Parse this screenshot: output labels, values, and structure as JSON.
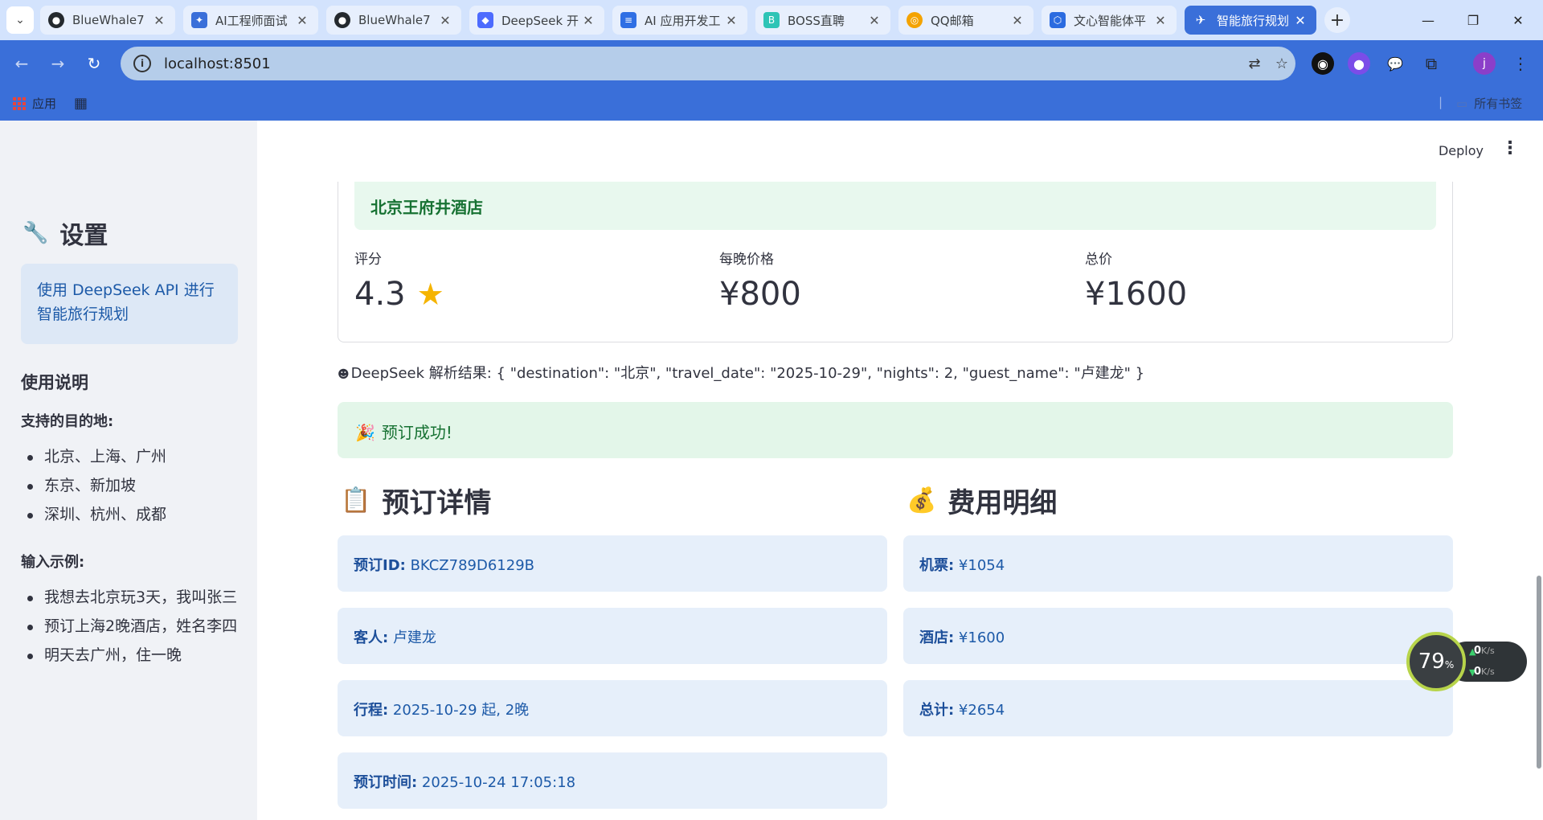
{
  "browser": {
    "tabs": [
      {
        "title": "BlueWhale7",
        "icon": "github-icon",
        "color": "#24292e"
      },
      {
        "title": "AI工程师面试",
        "icon": "bird-icon",
        "color": "#3a6fd9"
      },
      {
        "title": "BlueWhale7",
        "icon": "github-icon",
        "color": "#24292e"
      },
      {
        "title": "DeepSeek 开",
        "icon": "whale-icon",
        "color": "#4d6bfe"
      },
      {
        "title": "AI 应用开发工",
        "icon": "doc-icon",
        "color": "#2f6fe4"
      },
      {
        "title": "BOSS直聘",
        "icon": "boss-icon",
        "color": "#2ec4b6"
      },
      {
        "title": "QQ邮箱",
        "icon": "qqmail-icon",
        "color": "#f4a300"
      },
      {
        "title": "文心智能体平",
        "icon": "cube-icon",
        "color": "#2b6be0"
      },
      {
        "title": "智能旅行规划",
        "icon": "plane-icon",
        "color": "#ffffff"
      }
    ],
    "url": "localhost:8501",
    "bookmarks": {
      "apps_label": "应用",
      "all_bookmarks_label": "所有书签"
    }
  },
  "header": {
    "deploy_label": "Deploy"
  },
  "sidebar": {
    "title": "设置",
    "info": "使用 DeepSeek API 进行智能旅行规划",
    "usage_heading": "使用说明",
    "destinations_heading": "支持的目的地:",
    "destinations": [
      "北京、上海、广州",
      "东京、新加坡",
      "深圳、杭州、成都"
    ],
    "examples_heading": "输入示例:",
    "examples": [
      "我想去北京玩3天，我叫张三",
      "预订上海2晚酒店，姓名李四",
      "明天去广州，住一晚"
    ]
  },
  "hotel": {
    "name": "北京王府井酒店",
    "rating_label": "评分",
    "rating_value": "4.3",
    "nightly_label": "每晚价格",
    "nightly_value": "¥800",
    "total_label": "总价",
    "total_value": "¥1600"
  },
  "parse_result": "DeepSeek 解析结果: { \"destination\": \"北京\", \"travel_date\": \"2025-10-29\", \"nights\": 2, \"guest_name\": \"卢建龙\" }",
  "success_message": "预订成功!",
  "booking": {
    "heading": "预订详情",
    "rows": [
      {
        "label": "预订ID:",
        "value": " BKCZ789D6129B"
      },
      {
        "label": "客人:",
        "value": " 卢建龙"
      },
      {
        "label": "行程:",
        "value": " 2025-10-29 起, 2晚"
      },
      {
        "label": "预订时间:",
        "value": " 2025-10-24 17:05:18"
      }
    ]
  },
  "costs": {
    "heading": "费用明细",
    "rows": [
      {
        "label": "机票:",
        "value": " ¥1054"
      },
      {
        "label": "酒店:",
        "value": " ¥1600"
      },
      {
        "label": "总计:",
        "value": " ¥2654"
      }
    ]
  },
  "system_monitor": {
    "cpu_percent": "79",
    "percent_sign": "%",
    "upload": "0",
    "download": "0",
    "unit": "K/s"
  }
}
